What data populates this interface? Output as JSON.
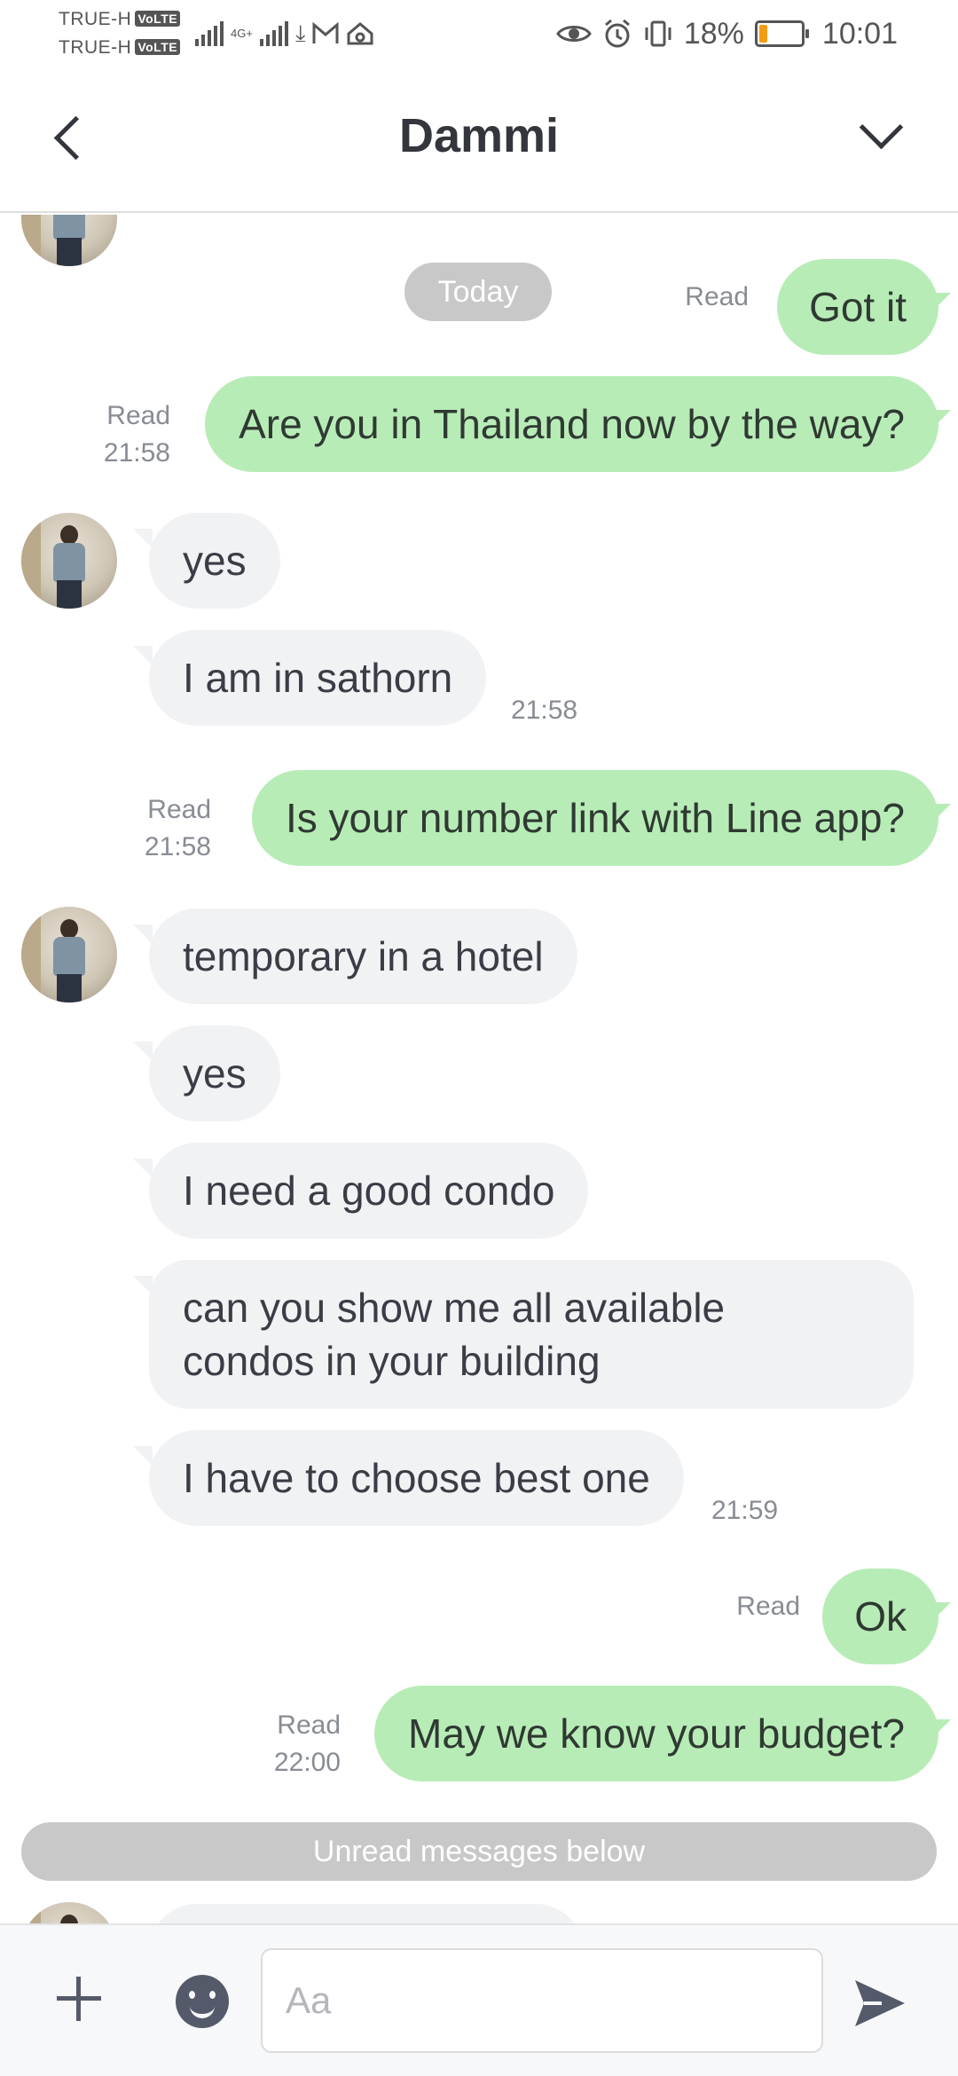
{
  "status_bar": {
    "carrier1": "TRUE-H",
    "carrier2": "TRUE-H",
    "volte_badge": "VoLTE",
    "network": "4G+",
    "battery_text": "18%",
    "battery_level": 0.18,
    "time": "10:01"
  },
  "header": {
    "title": "Dammi"
  },
  "chat": {
    "date_divider": "Today",
    "unread_divider": "Unread messages below",
    "messages": [
      {
        "dir": "out",
        "text": "Got it",
        "status": "Read",
        "time": ""
      },
      {
        "dir": "out",
        "text": "Are you in Thailand now by the way?",
        "status": "Read",
        "time": "21:58"
      },
      {
        "dir": "in",
        "text": "yes",
        "time": ""
      },
      {
        "dir": "in",
        "text": "I am in sathorn",
        "time": "21:58"
      },
      {
        "dir": "out",
        "text": "Is your number link with Line app?",
        "status": "Read",
        "time": "21:58"
      },
      {
        "dir": "in",
        "text": "temporary in a hotel",
        "time": ""
      },
      {
        "dir": "in",
        "text": "yes",
        "time": ""
      },
      {
        "dir": "in",
        "text": "I need a good condo",
        "time": ""
      },
      {
        "dir": "in",
        "text": "can you show me all available condos in your building",
        "time": ""
      },
      {
        "dir": "in",
        "text": "I have to choose best one",
        "time": "21:59"
      },
      {
        "dir": "out",
        "text": "Ok",
        "status": "Read",
        "time": ""
      },
      {
        "dir": "out",
        "text": "May we know your budget?",
        "status": "Read",
        "time": "22:00"
      }
    ]
  },
  "input": {
    "placeholder": "Aa"
  },
  "colors": {
    "outgoing_bubble": "#b8ecb7",
    "incoming_bubble": "#f1f2f4",
    "divider_pill": "#c8c8c8",
    "battery_low": "#f39c12"
  },
  "icons": {
    "back": "chevron-left-icon",
    "menu": "chevron-down-icon",
    "add": "plus-icon",
    "emoji": "smiley-icon",
    "send": "send-icon"
  }
}
